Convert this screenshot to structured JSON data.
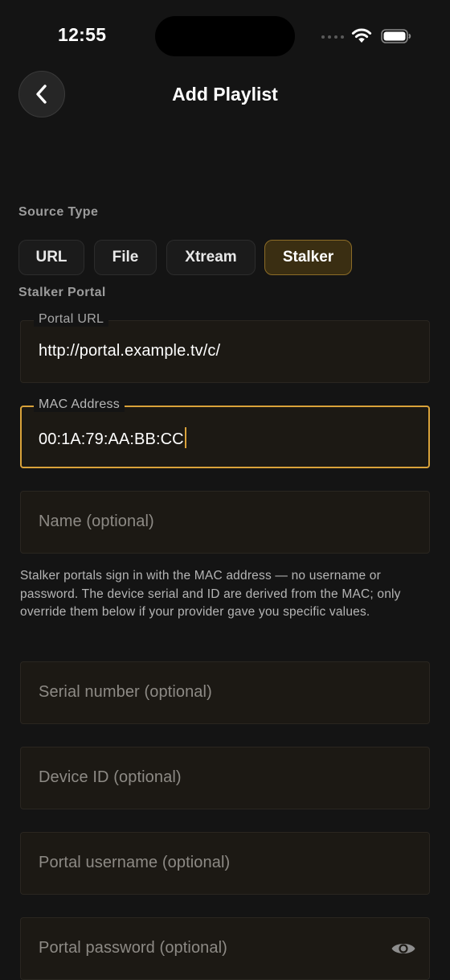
{
  "status_bar": {
    "time": "12:55",
    "icons": [
      "signal-dots-icon",
      "wifi-icon",
      "battery-icon"
    ]
  },
  "header": {
    "back_icon": "chevron-left-icon",
    "title": "Add Playlist"
  },
  "source_type": {
    "label": "Source Type",
    "options": [
      "URL",
      "File",
      "Xtream",
      "Stalker"
    ],
    "selected": "Stalker"
  },
  "stalker": {
    "section_label": "Stalker Portal",
    "portal_url": {
      "label": "Portal URL",
      "value": "http://portal.example.tv/c/"
    },
    "mac_address": {
      "label": "MAC Address",
      "value": "00:1A:79:AA:BB:CC",
      "focused": true
    },
    "name": {
      "placeholder": "Name (optional)"
    },
    "help_text": "Stalker portals sign in with the MAC address — no username or password. The device serial and ID are derived from the MAC; only override them below if your provider gave you specific values.",
    "serial_number": {
      "placeholder": "Serial number (optional)"
    },
    "device_id": {
      "placeholder": "Device ID (optional)"
    },
    "portal_username": {
      "placeholder": "Portal username (optional)"
    },
    "portal_password": {
      "placeholder": "Portal password (optional)",
      "toggle_icon": "eye-icon"
    }
  },
  "colors": {
    "background": "#141414",
    "accent": "#d9a23a",
    "selected_segment_bg": "#3a2e12",
    "field_bg": "#1c1914"
  }
}
